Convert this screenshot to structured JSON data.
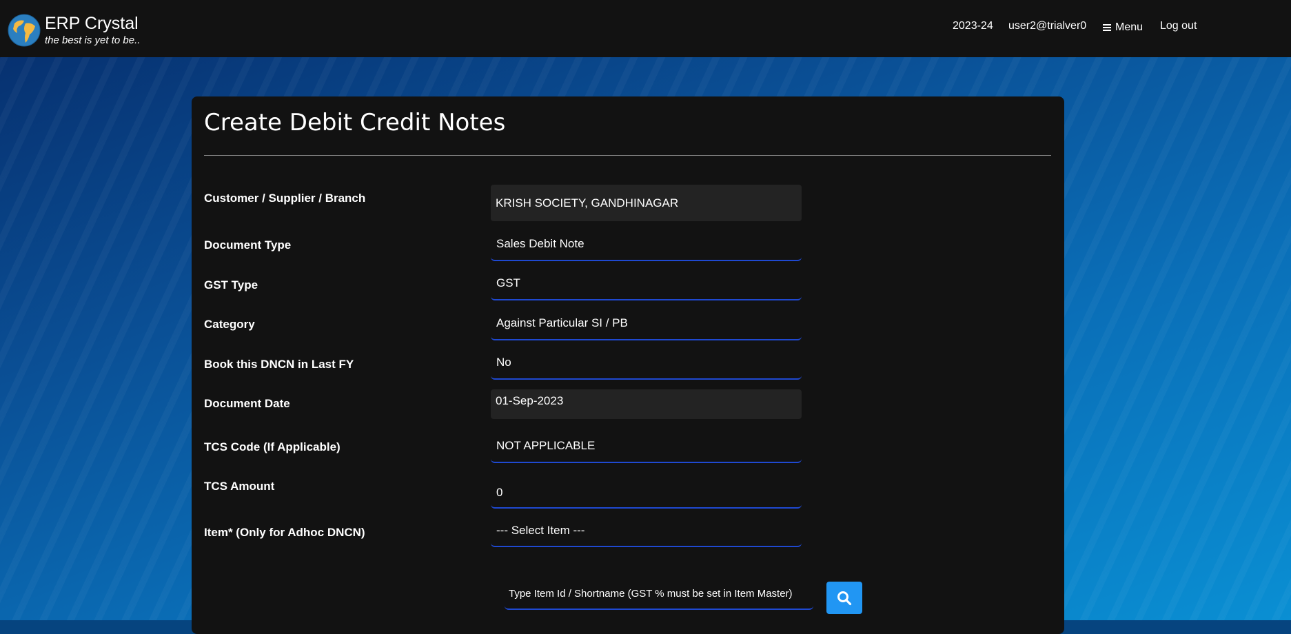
{
  "brand": {
    "name": "ERP Crystal",
    "tagline": "the best is yet to be..",
    "logo_icon": "globe-icon"
  },
  "nav": {
    "fiscal_year": "2023-24",
    "user": "user2@trialver0",
    "menu_label": "Menu",
    "menu_icon": "hamburger-icon",
    "logout_label": "Log out"
  },
  "page": {
    "title": "Create Debit Credit Notes"
  },
  "form": {
    "fields": [
      {
        "label": "Customer / Supplier / Branch",
        "value": "KRISH SOCIETY, GANDHINAGAR",
        "readonly": true
      },
      {
        "label": "Document Type",
        "value": "Sales Debit Note"
      },
      {
        "label": "GST Type",
        "value": "GST"
      },
      {
        "label": "Category",
        "value": "Against Particular SI / PB"
      },
      {
        "label": "Book this DNCN in Last FY",
        "value": "No"
      },
      {
        "label": "Document Date",
        "value": "01-Sep-2023",
        "readonly": true
      },
      {
        "label": "TCS Code (If Applicable)",
        "value": "NOT APPLICABLE"
      },
      {
        "label": "TCS Amount",
        "value": "0"
      },
      {
        "label": "Item* (Only for Adhoc DNCN)",
        "value": "--- Select Item ---"
      }
    ],
    "item_search": {
      "placeholder": "Type Item Id / Shortname (GST % must be set in Item Master)",
      "button_icon": "search-icon"
    }
  },
  "colors": {
    "topbar": "#121212",
    "card": "#121212",
    "accent": "#1f49d1",
    "search_button": "#2196f3",
    "readonly_field": "#232323"
  }
}
